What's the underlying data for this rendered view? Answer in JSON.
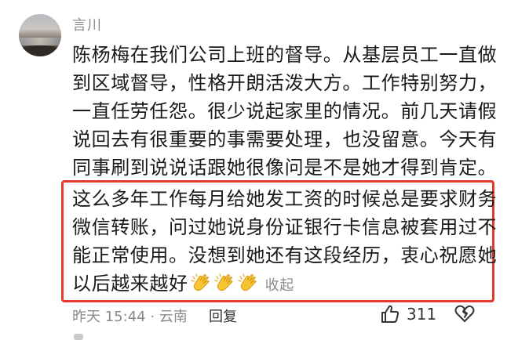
{
  "comment": {
    "username": "言川",
    "lines": [
      "陈杨梅在我们公司上班的督导。从基层员工一直做",
      "到区域督导，性格开朗活泼大方。工作特别努力，",
      "一直任劳任怨。很少说起家里的情况。前几天请假",
      "说回去有很重要的事需要处理，也没留意。今天有",
      "同事刷到说说话跟她很像问是不是她才得到肯定。"
    ],
    "highlighted_lines": [
      "这么多年工作每月给她发工资的时候总是要求财务",
      "微信转账，问过她说身份证银行卡信息被套用过不",
      "能正常使用。没想到她还有这段经历，衷心祝愿她",
      "以后越来越好"
    ],
    "emoji": [
      "clapping-hands",
      "clapping-hands",
      "clapping-hands"
    ],
    "collapse_label": "收起",
    "time": "昨天 15:44",
    "separator": "·",
    "location": "云南",
    "reply_label": "回复",
    "like_count": "311",
    "highlight_color": "#e23a2c"
  }
}
